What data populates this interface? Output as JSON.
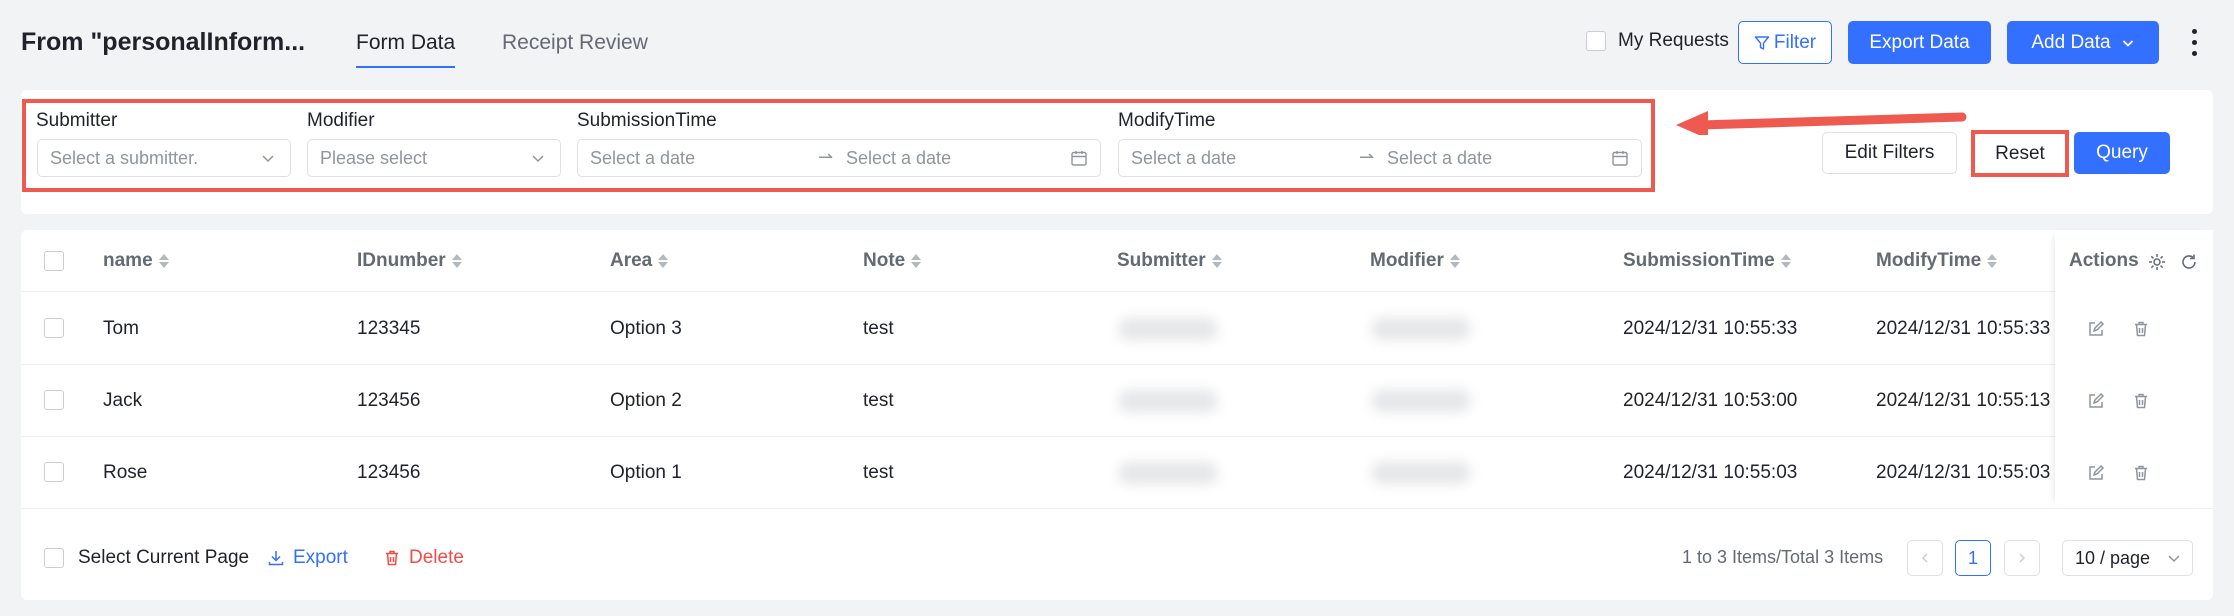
{
  "header": {
    "title": "From \"personalInform...",
    "tabs": [
      {
        "label": "Form Data",
        "active": true
      },
      {
        "label": "Receipt Review",
        "active": false
      }
    ],
    "my_requests_label": "My Requests",
    "filter_label": "Filter",
    "export_label": "Export Data",
    "add_label": "Add Data"
  },
  "filters": {
    "submitter": {
      "label": "Submitter",
      "placeholder": "Select a submitter."
    },
    "modifier": {
      "label": "Modifier",
      "placeholder": "Please select"
    },
    "submission_time": {
      "label": "SubmissionTime",
      "start_placeholder": "Select a date",
      "end_placeholder": "Select a date"
    },
    "modify_time": {
      "label": "ModifyTime",
      "start_placeholder": "Select a date",
      "end_placeholder": "Select a date"
    },
    "edit_filters_label": "Edit Filters",
    "reset_label": "Reset",
    "query_label": "Query"
  },
  "table": {
    "columns": [
      "name",
      "IDnumber",
      "Area",
      "Note",
      "Submitter",
      "Modifier",
      "SubmissionTime",
      "ModifyTime"
    ],
    "actions_label": "Actions",
    "rows": [
      {
        "name": "Tom",
        "id": "123345",
        "area": "Option 3",
        "note": "test",
        "submission_time": "2024/12/31 10:55:33",
        "modify_time": "2024/12/31 10:55:33"
      },
      {
        "name": "Jack",
        "id": "123456",
        "area": "Option 2",
        "note": "test",
        "submission_time": "2024/12/31 10:53:00",
        "modify_time": "2024/12/31 10:55:13"
      },
      {
        "name": "Rose",
        "id": "123456",
        "area": "Option 1",
        "note": "test",
        "submission_time": "2024/12/31 10:55:03",
        "modify_time": "2024/12/31 10:55:03"
      }
    ]
  },
  "footer": {
    "select_page_label": "Select Current Page",
    "export_label": "Export",
    "delete_label": "Delete",
    "pager_info": "1 to 3 Items/Total 3 Items",
    "current_page": "1",
    "page_size": "10 / page"
  },
  "colors": {
    "accent": "#3370ff",
    "highlight": "#ee5a4f",
    "danger": "#f54a45"
  }
}
